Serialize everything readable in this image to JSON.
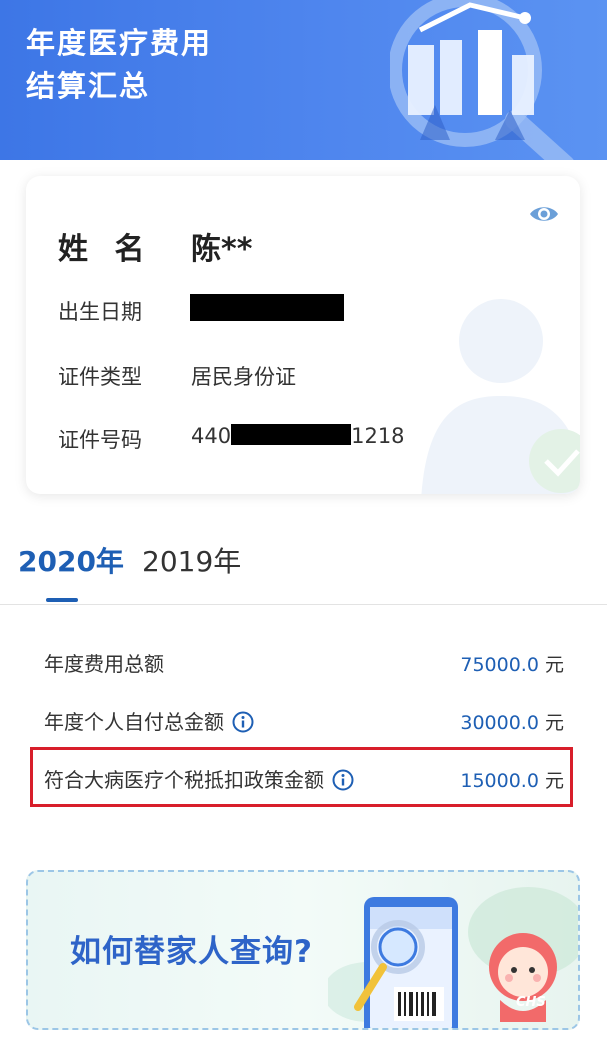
{
  "header": {
    "title_line1": "年度医疗费用",
    "title_line2": "结算汇总"
  },
  "profile": {
    "name_label": "姓 名",
    "name_value": "陈**",
    "birth_label": "出生日期",
    "id_type_label": "证件类型",
    "id_type_value": "居民身份证",
    "id_number_label": "证件号码",
    "id_number_prefix": "440",
    "id_number_suffix": "1218"
  },
  "tabs": [
    {
      "label": "2020年",
      "active": true
    },
    {
      "label": "2019年",
      "active": false
    }
  ],
  "summary": [
    {
      "label": "年度费用总额",
      "amount": "75000.0",
      "unit": "元",
      "has_info": false
    },
    {
      "label": "年度个人自付总金额",
      "amount": "30000.0",
      "unit": "元",
      "has_info": true
    },
    {
      "label": "符合大病医疗个税抵扣政策金额",
      "amount": "15000.0",
      "unit": "元",
      "has_info": true,
      "highlighted": true
    }
  ],
  "banner": {
    "text": "如何替家人查询?",
    "mascot_badge": "CHS"
  },
  "colors": {
    "header_blue": "#4a82ec",
    "accent_blue": "#1e5fb4",
    "highlight_red": "#d81e2a"
  }
}
